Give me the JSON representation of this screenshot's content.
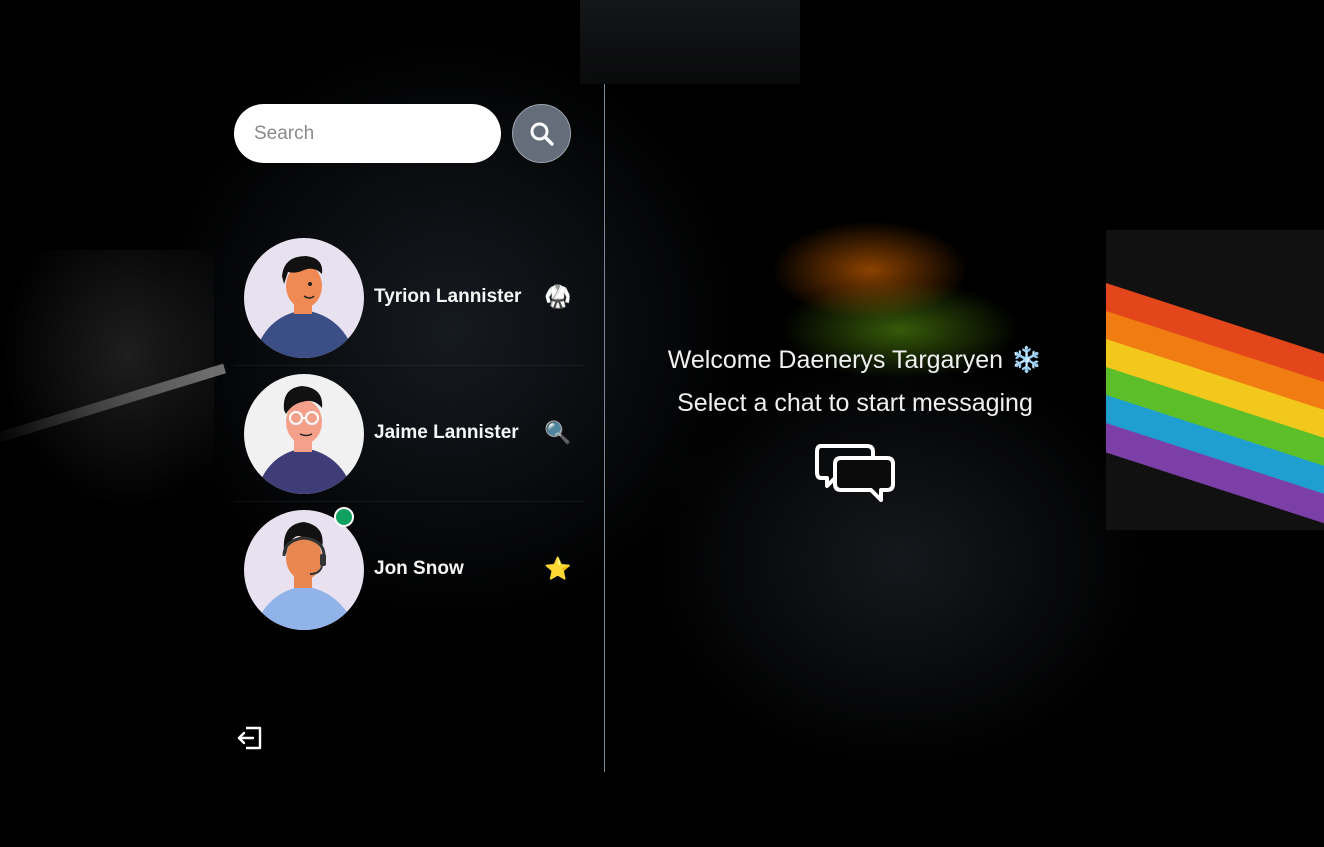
{
  "search": {
    "placeholder": "Search",
    "button_icon": "search-icon"
  },
  "contacts": [
    {
      "name": "Tyrion Lannister",
      "emoji": "🥋",
      "online": false,
      "avatar_skin": "#f08a55",
      "avatar_shirt": "#3b4f86",
      "avatar_bg": "#e8e2f0"
    },
    {
      "name": "Jaime Lannister",
      "emoji": "🔍",
      "online": false,
      "avatar_skin": "#f4a08a",
      "avatar_shirt": "#3e3d78",
      "avatar_bg": "#f1f1f1"
    },
    {
      "name": "Jon Snow",
      "emoji": "⭐",
      "online": true,
      "avatar_skin": "#e98750",
      "avatar_shirt": "#90b4ea",
      "avatar_bg": "#e8e2f0"
    }
  ],
  "welcome": {
    "greeting": "Welcome Daenerys Targaryen",
    "greeting_emoji": "❄️",
    "subtitle": "Select a chat to start messaging",
    "chat_icon": "chat-bubbles-icon"
  },
  "footer": {
    "logout_icon": "logout-icon"
  },
  "colors": {
    "divider": "#7a8797",
    "search_button": "#656d7b",
    "online": "#10a060"
  }
}
